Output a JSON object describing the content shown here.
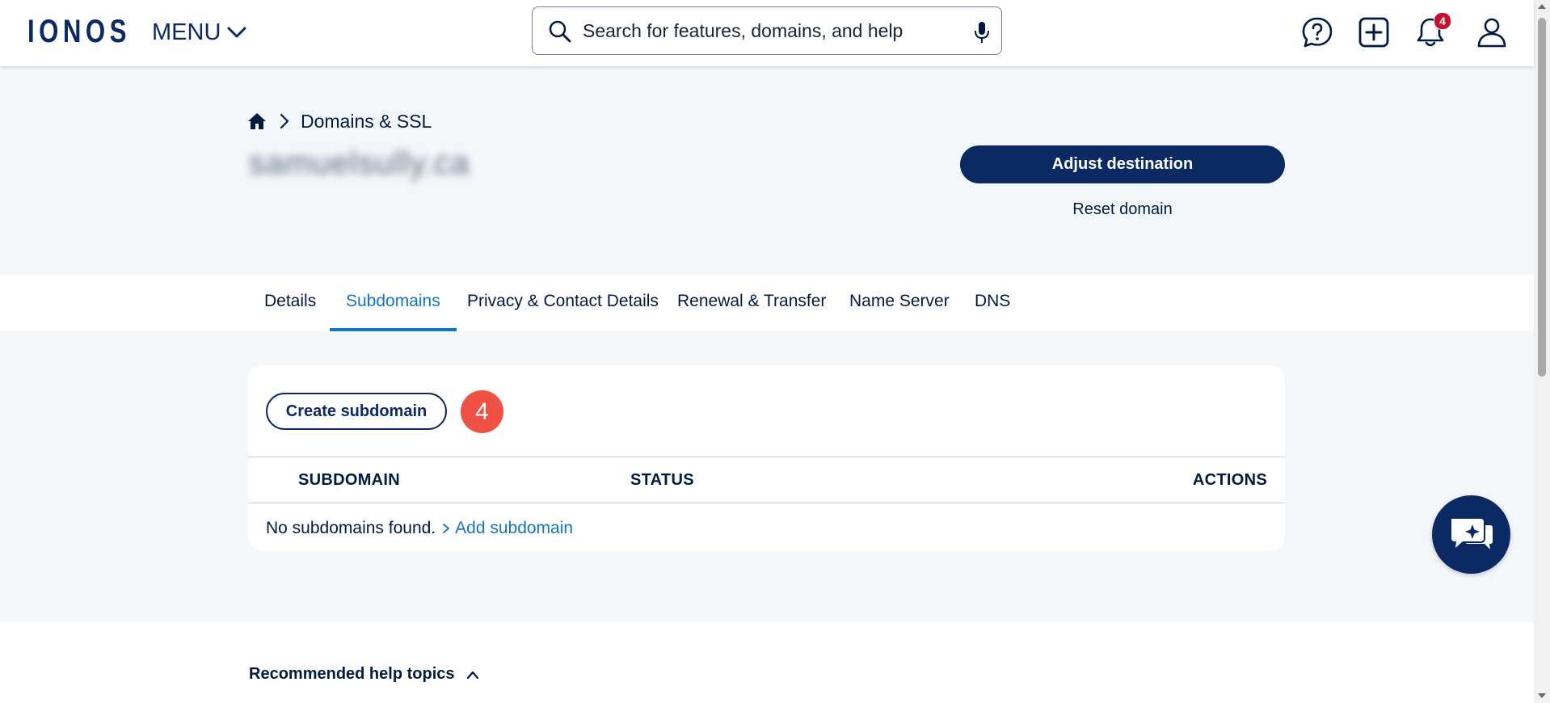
{
  "header": {
    "logo": "IONOS",
    "menu_label": "MENU",
    "search": {
      "placeholder": "Search for features, domains, and help",
      "value": ""
    },
    "notifications_count": "4",
    "icons": [
      "help-icon",
      "add-icon",
      "bell-icon",
      "user-icon"
    ]
  },
  "breadcrumb": {
    "home_icon": "home-icon",
    "current": "Domains & SSL"
  },
  "domain": {
    "name": "samuelsully.ca"
  },
  "actions": {
    "primary": "Adjust destination",
    "secondary": "Reset domain"
  },
  "tabs": [
    {
      "label": "Details",
      "active": false
    },
    {
      "label": "Subdomains",
      "active": true
    },
    {
      "label": "Privacy & Contact Details",
      "active": false
    },
    {
      "label": "Renewal & Transfer",
      "active": false
    },
    {
      "label": "Name Server",
      "active": false
    },
    {
      "label": "DNS",
      "active": false
    }
  ],
  "subdomains": {
    "create_label": "Create subdomain",
    "step_marker": "4",
    "columns": [
      "SUBDOMAIN",
      "STATUS",
      "ACTIONS"
    ],
    "empty_text": "No subdomains found.",
    "add_link": "Add subdomain"
  },
  "help": {
    "title": "Recommended help topics"
  },
  "colors": {
    "brand": "#0b2a63",
    "link": "#1474c4",
    "background": "#f4f7fa",
    "step_marker": "#ef5244",
    "badge": "#c8102e"
  }
}
